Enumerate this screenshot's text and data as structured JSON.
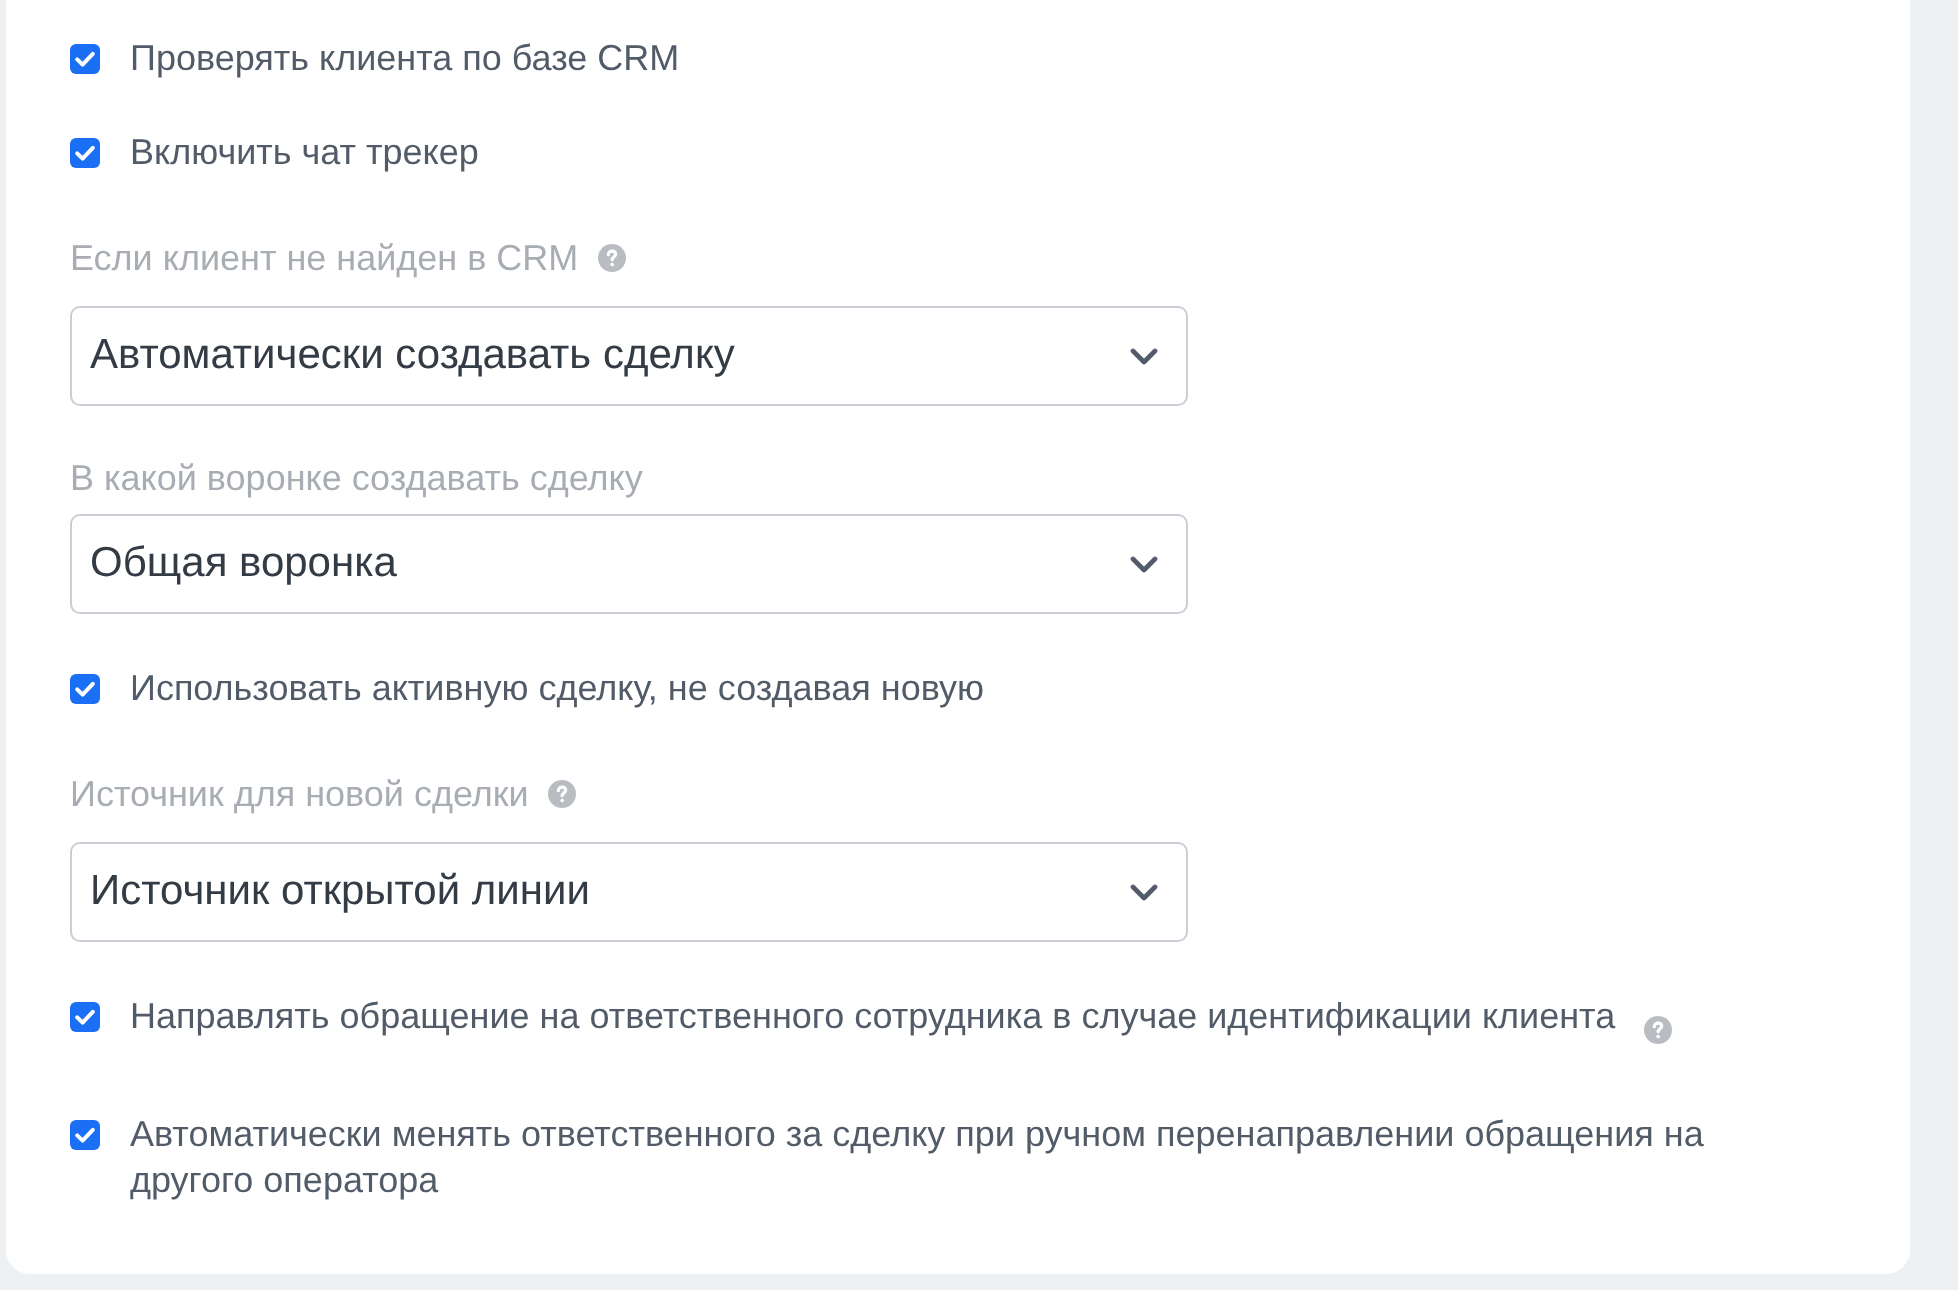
{
  "settings": [
    {
      "kind": "checkbox",
      "label": "Проверять клиента по базе CRM",
      "checked": true
    },
    {
      "kind": "checkbox",
      "label": "Включить чат трекер",
      "checked": true
    },
    {
      "kind": "select",
      "label": "Если клиент не найден в CRM",
      "help": true,
      "value": "Автоматически создавать сделку"
    },
    {
      "kind": "select",
      "label": "В какой воронке создавать сделку",
      "value": "Общая воронка"
    },
    {
      "kind": "checkbox",
      "label": "Использовать активную сделку, не создавая новую",
      "checked": true
    },
    {
      "kind": "select",
      "label": "Источник для новой сделки",
      "help": true,
      "value": "Источник открытой линии"
    },
    {
      "kind": "checkbox",
      "label": "Направлять обращение на ответственного сотрудника в случае идентификации клиента",
      "checked": true,
      "help": true
    },
    {
      "kind": "checkbox",
      "label": "Автоматически менять ответственного за сделку при ручном перенаправлении обращения на другого оператора",
      "checked": true
    }
  ]
}
